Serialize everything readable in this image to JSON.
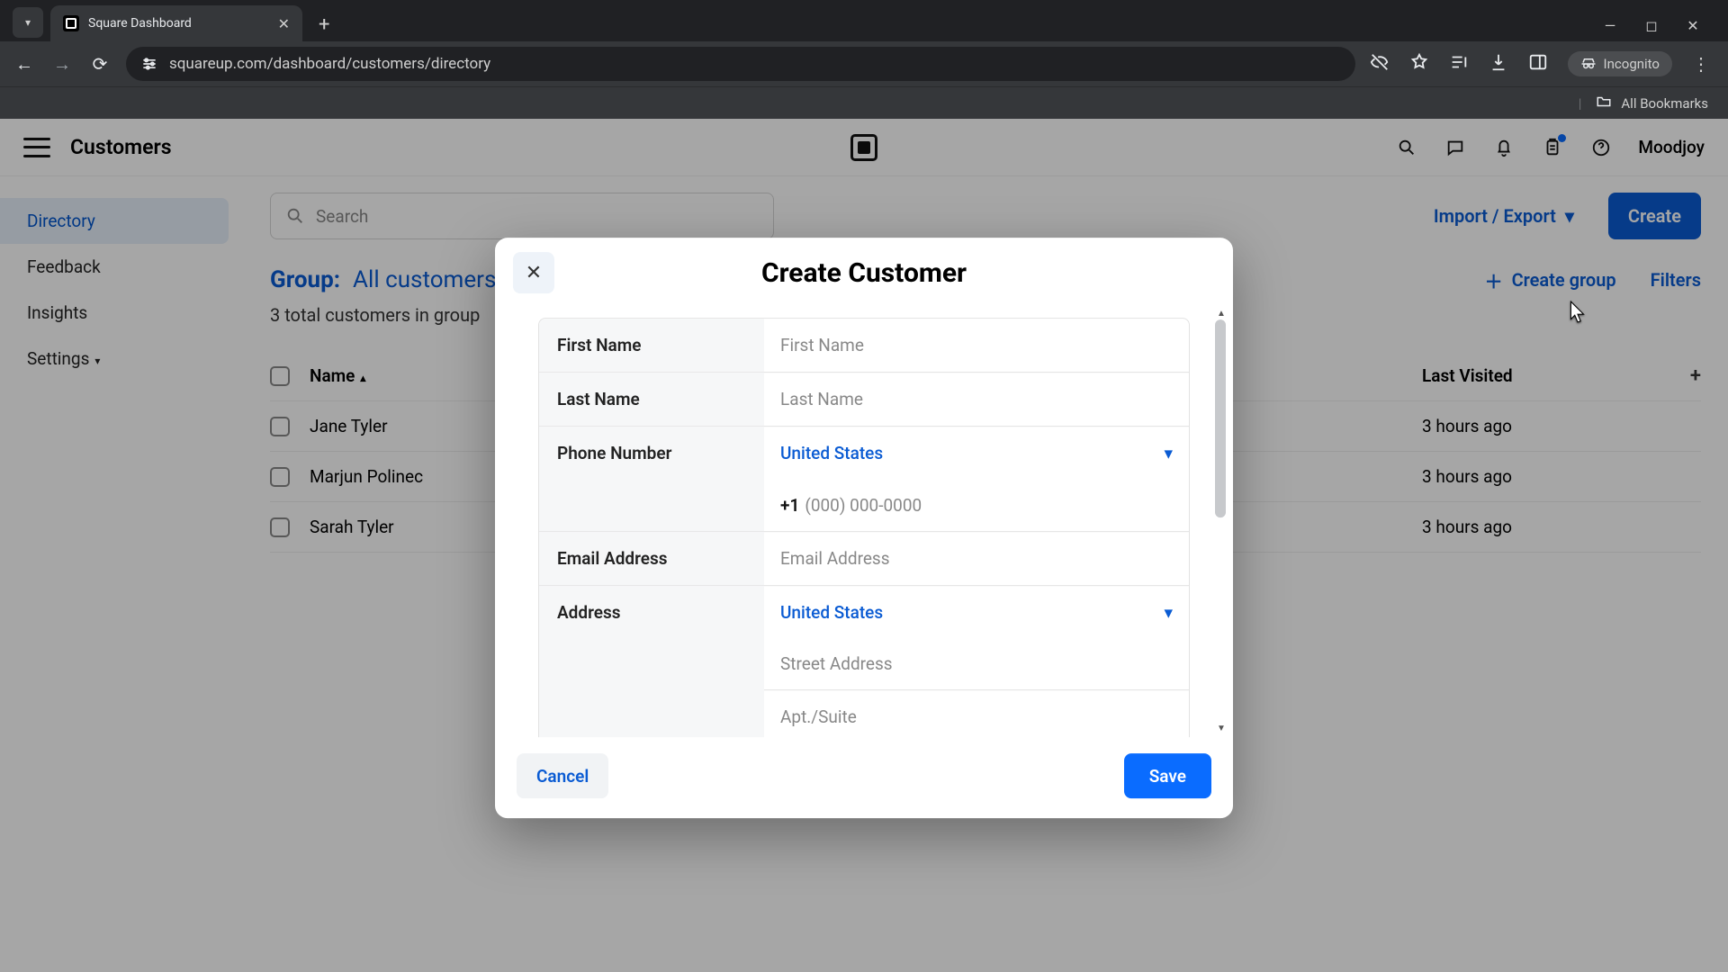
{
  "browser": {
    "tab_title": "Square Dashboard",
    "url": "squareup.com/dashboard/customers/directory",
    "incognito_label": "Incognito",
    "all_bookmarks": "All Bookmarks"
  },
  "header": {
    "title": "Customers",
    "username": "Moodjoy"
  },
  "sidebar": {
    "items": [
      {
        "label": "Directory",
        "active": true
      },
      {
        "label": "Feedback"
      },
      {
        "label": "Insights"
      },
      {
        "label": "Settings",
        "has_submenu": true
      }
    ]
  },
  "toolbar": {
    "search_placeholder": "Search",
    "import_export": "Import / Export",
    "create": "Create"
  },
  "group": {
    "label": "Group:",
    "name": "All customers",
    "create_group": "Create group",
    "filters": "Filters",
    "count_text": "3 total customers in group"
  },
  "table": {
    "col_name": "Name",
    "col_last": "Last Visited",
    "rows": [
      {
        "name": "Jane Tyler",
        "last": "3 hours ago"
      },
      {
        "name": "Marjun Polinec",
        "last": "3 hours ago"
      },
      {
        "name": "Sarah Tyler",
        "last": "3 hours ago"
      }
    ]
  },
  "modal": {
    "title": "Create Customer",
    "fields": {
      "first_name_label": "First Name",
      "first_name_ph": "First Name",
      "last_name_label": "Last Name",
      "last_name_ph": "Last Name",
      "phone_label": "Phone Number",
      "phone_country": "United States",
      "phone_prefix": "+1",
      "phone_ph": "(000) 000-0000",
      "email_label": "Email Address",
      "email_ph": "Email Address",
      "address_label": "Address",
      "address_country": "United States",
      "street_ph": "Street Address",
      "apt_ph": "Apt./Suite"
    },
    "cancel": "Cancel",
    "save": "Save"
  }
}
